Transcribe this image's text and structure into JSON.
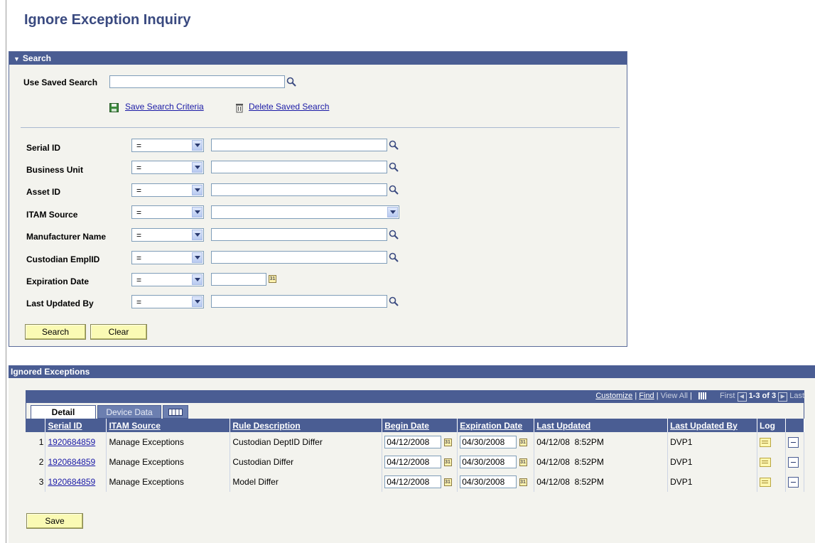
{
  "page": {
    "title": "Ignore Exception Inquiry"
  },
  "search": {
    "header": "Search",
    "saved_search_label": "Use Saved Search",
    "saved_search_value": "",
    "save_criteria_link": "Save Search Criteria",
    "delete_saved_link": "Delete Saved Search",
    "fields": [
      {
        "label": "Serial ID",
        "operator": "=",
        "value": ""
      },
      {
        "label": "Business Unit",
        "operator": "=",
        "value": ""
      },
      {
        "label": "Asset ID",
        "operator": "=",
        "value": ""
      },
      {
        "label": "ITAM Source",
        "operator": "=",
        "value": ""
      },
      {
        "label": "Manufacturer Name",
        "operator": "=",
        "value": ""
      },
      {
        "label": "Custodian EmplID",
        "operator": "=",
        "value": ""
      },
      {
        "label": "Expiration Date",
        "operator": "=",
        "value": ""
      },
      {
        "label": "Last Updated By",
        "operator": "=",
        "value": ""
      }
    ],
    "search_button": "Search",
    "clear_button": "Clear"
  },
  "exceptions": {
    "header": "Ignored Exceptions",
    "nav": {
      "customize": "Customize",
      "find": "Find",
      "view_all": "View All",
      "first": "First",
      "range": "1-3 of 3",
      "last": "Last"
    },
    "tabs": {
      "detail": "Detail",
      "device_data": "Device Data"
    },
    "columns": {
      "serial_id": "Serial ID",
      "itam_source": "ITAM Source",
      "rule_description": "Rule Description",
      "begin_date": "Begin Date",
      "expiration_date": "Expiration Date",
      "last_updated": "Last Updated",
      "last_updated_by": "Last Updated By",
      "log": "Log"
    },
    "rows": [
      {
        "num": "1",
        "serial_id": "1920684859",
        "itam_source": "Manage Exceptions",
        "rule_description": "Custodian DeptID Differ",
        "begin_date": "04/12/2008",
        "expiration_date": "04/30/2008",
        "last_updated": "04/12/08  8:52PM",
        "last_updated_by": "DVP1"
      },
      {
        "num": "2",
        "serial_id": "1920684859",
        "itam_source": "Manage Exceptions",
        "rule_description": "Custodian Differ",
        "begin_date": "04/12/2008",
        "expiration_date": "04/30/2008",
        "last_updated": "04/12/08  8:52PM",
        "last_updated_by": "DVP1"
      },
      {
        "num": "3",
        "serial_id": "1920684859",
        "itam_source": "Manage Exceptions",
        "rule_description": "Model Differ",
        "begin_date": "04/12/2008",
        "expiration_date": "04/30/2008",
        "last_updated": "04/12/08  8:52PM",
        "last_updated_by": "DVP1"
      }
    ],
    "save_button": "Save"
  },
  "colors": {
    "header_blue": "#4a5d93",
    "panel_bg": "#f3f3ee",
    "button_yellow": "#fafab4",
    "link_blue": "#1a1aa6"
  }
}
